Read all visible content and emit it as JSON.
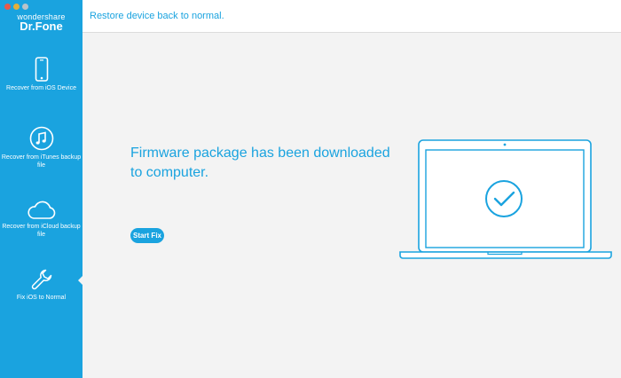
{
  "app": {
    "brand_small": "wondershare",
    "brand_big": "Dr.Fone"
  },
  "header": {
    "title": "Restore device back to normal."
  },
  "sidebar": {
    "items": [
      {
        "label": "Recover from iOS Device",
        "icon": "phone-icon"
      },
      {
        "label": "Recover from iTunes backup file",
        "icon": "music-note-icon"
      },
      {
        "label": "Recover from iCloud backup file",
        "icon": "cloud-icon"
      },
      {
        "label": "Fix iOS to Normal",
        "icon": "wrench-icon",
        "active": true
      }
    ]
  },
  "main": {
    "message": "Firmware package has been downloaded to computer.",
    "start_fix_label": "Start Fix",
    "illustration_icon": "laptop-check-icon"
  },
  "colors": {
    "accent": "#1aa3df",
    "background": "#f3f3f3"
  }
}
